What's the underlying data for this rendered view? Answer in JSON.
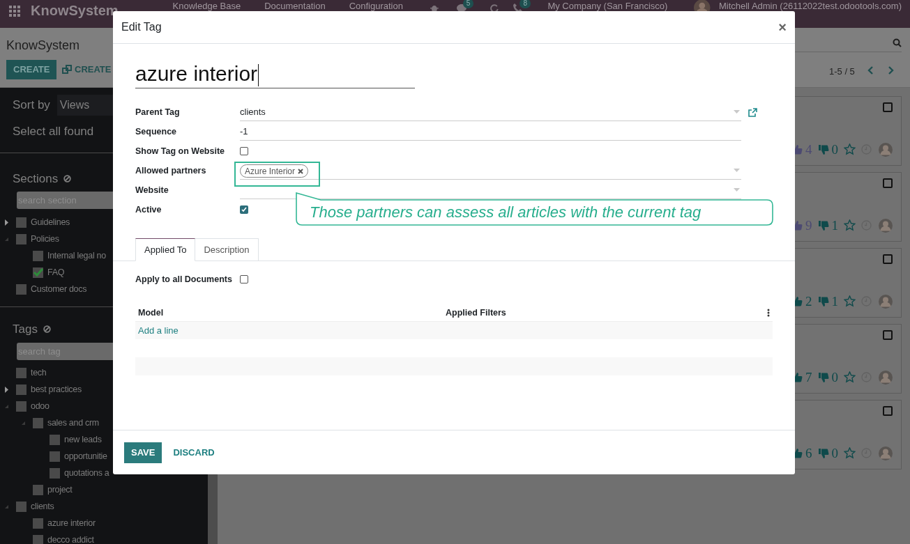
{
  "navbar": {
    "app_name": "KnowSystem",
    "menus": [
      "Knowledge Base",
      "Documentation",
      "Configuration"
    ],
    "activity_count": "5",
    "notification_count": "8",
    "company": "My Company (San Francisco)",
    "user": "Mitchell Admin (26112022test.odootools.com)"
  },
  "control_panel": {
    "breadcrumb": "KnowSystem",
    "create": "CREATE",
    "create_from": "CREATE",
    "pager": "1-5 / 5"
  },
  "sidebar": {
    "sort_label": "Sort by",
    "sort_value": "Views",
    "select_all": "Select all found",
    "sections": {
      "title": "Sections",
      "placeholder": "search section",
      "items": [
        {
          "label": "Guidelines",
          "expanded": false,
          "checked": false
        },
        {
          "label": "Policies",
          "expanded": true,
          "checked": false,
          "children": [
            {
              "label": "Internal legal no",
              "checked": false
            },
            {
              "label": "FAQ",
              "checked": true
            }
          ]
        },
        {
          "label": "Customer docs",
          "checked": false
        }
      ]
    },
    "tags": {
      "title": "Tags",
      "placeholder": "search tag",
      "items": [
        {
          "label": "tech",
          "checked": false
        },
        {
          "label": "best practices",
          "expanded": false,
          "checked": false
        },
        {
          "label": "odoo",
          "expanded": true,
          "checked": false,
          "children": [
            {
              "label": "sales and crm",
              "expanded": true,
              "checked": false,
              "children": [
                {
                  "label": "new leads",
                  "checked": false
                },
                {
                  "label": "opportunitie",
                  "checked": false
                },
                {
                  "label": "quotations a",
                  "checked": false
                }
              ]
            },
            {
              "label": "project",
              "checked": false
            }
          ]
        },
        {
          "label": "clients",
          "expanded": true,
          "checked": false,
          "children": [
            {
              "label": "azure interior",
              "checked": false
            },
            {
              "label": "decco addict",
              "checked": false
            }
          ]
        }
      ]
    }
  },
  "cards": [
    {
      "likes": "4",
      "dislikes": "0",
      "liked": true,
      "checked": false
    },
    {
      "likes": "9",
      "dislikes": "1",
      "liked": true,
      "checked": false
    },
    {
      "likes": "2",
      "dislikes": "1",
      "liked": false,
      "checked": false
    },
    {
      "likes": "7",
      "dislikes": "0",
      "liked": false,
      "checked": false
    },
    {
      "likes": "6",
      "dislikes": "0",
      "liked": false,
      "checked": false
    }
  ],
  "dialog": {
    "title": "Edit Tag",
    "close": "×",
    "name": "azure interior",
    "fields": [
      {
        "label": "Parent Tag",
        "kind": "many2one",
        "value": "clients",
        "open_link": true
      },
      {
        "label": "Sequence",
        "kind": "text",
        "value": "-1"
      },
      {
        "label": "Show Tag on Website",
        "kind": "checkbox",
        "checked": false
      },
      {
        "label": "Allowed partners",
        "kind": "tags",
        "tags": [
          "Azure Interior"
        ]
      },
      {
        "label": "Website",
        "kind": "many2one",
        "open_link": false
      },
      {
        "label": "Active",
        "kind": "checkbox",
        "checked": true
      }
    ],
    "callout": "Those partners can assess all articles with the current tag",
    "tabs": [
      {
        "label": "Applied To",
        "selected": true
      },
      {
        "label": "Description",
        "selected": false
      }
    ],
    "apply_all": {
      "label": "Apply to all Documents",
      "checked": false
    },
    "table": {
      "columns": [
        "Model",
        "Applied Filters"
      ],
      "add_line": "Add a line"
    },
    "save": "SAVE",
    "discard": "DISCARD"
  }
}
